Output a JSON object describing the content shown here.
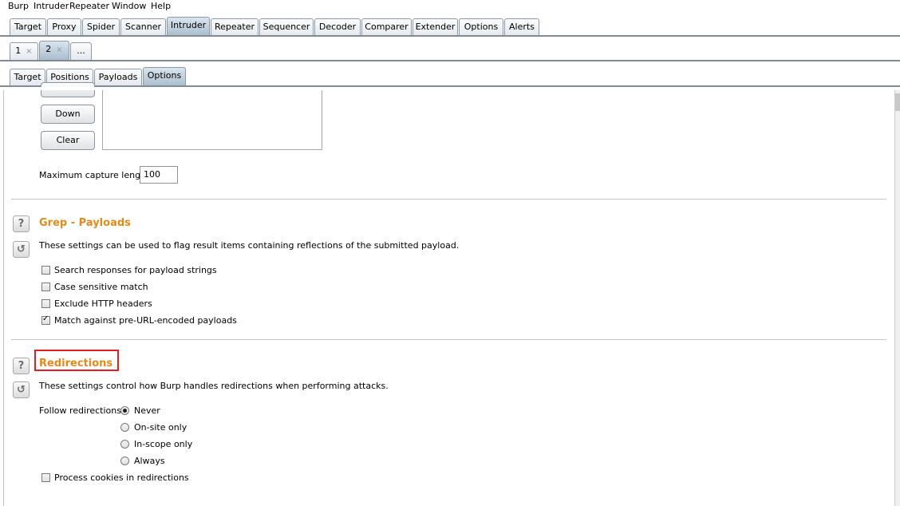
{
  "menubar": [
    "Burp",
    "Intruder",
    "Repeater",
    "Window",
    "Help"
  ],
  "main_tabs": [
    "Target",
    "Proxy",
    "Spider",
    "Scanner",
    "Intruder",
    "Repeater",
    "Sequencer",
    "Decoder",
    "Comparer",
    "Extender",
    "Options",
    "Alerts"
  ],
  "main_tabs_active": "Intruder",
  "attack_tabs": [
    {
      "label": "1",
      "close": "×"
    },
    {
      "label": "2",
      "close": "×"
    },
    {
      "label": "..."
    }
  ],
  "attack_tabs_active": "2",
  "sub_tabs": [
    "Target",
    "Positions",
    "Payloads",
    "Options"
  ],
  "sub_tabs_active": "Options",
  "capture": {
    "down_button": "Down",
    "clear_button": "Clear",
    "max_length_label": "Maximum capture length:",
    "max_length_value": "100"
  },
  "grep_payloads": {
    "title": "Grep - Payloads",
    "description": "These settings can be used to flag result items containing reflections of the submitted payload.",
    "options": [
      {
        "label": "Search responses for payload strings",
        "checked": false
      },
      {
        "label": "Case sensitive match",
        "checked": false
      },
      {
        "label": "Exclude HTTP headers",
        "checked": false
      },
      {
        "label": "Match against pre-URL-encoded payloads",
        "checked": true
      }
    ]
  },
  "redirections": {
    "title": "Redirections",
    "description": "These settings control how Burp handles redirections when performing attacks.",
    "follow_label": "Follow redirections:",
    "follow_options": [
      "Never",
      "On-site only",
      "In-scope only",
      "Always"
    ],
    "follow_selected": "Never",
    "process_cookies_label": "Process cookies in redirections",
    "process_cookies_checked": false
  },
  "icons": {
    "help": "?",
    "restore": "↺"
  },
  "colors": {
    "section_title": "#e28a1b",
    "highlight": "#e02020"
  }
}
